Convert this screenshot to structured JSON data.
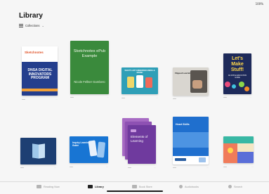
{
  "status": {
    "battery": "100%"
  },
  "header": {
    "title": "Library",
    "collections_label": "Collections"
  },
  "books": {
    "b1": {
      "brand": "Sketchnotes",
      "title": "DNSA DIGITAL INNOVATORS PROGRAM"
    },
    "b2": {
      "title": "Sketchnotes ePub Example",
      "author": "Nicole Fellner Gambero"
    },
    "b3": {
      "header": "WHAT'S ART EMBEDDED MEDIA & MORE!"
    },
    "b4": {
      "title": "Flipped Learning for Teaching"
    },
    "b5": {
      "title": "Let's Make Stuff!",
      "subtitle": "AN APPLE EDUCATION GUIDE"
    },
    "b7": {
      "title": "Inquiry Learning Guide"
    },
    "b8": {
      "title": "Elements of Learning"
    },
    "b9": {
      "title": "Heart Skills"
    }
  },
  "tabbar": {
    "reading_now": "Reading Now",
    "library": "Library",
    "book_store": "Book Store",
    "audiobooks": "Audiobooks",
    "search": "Search"
  },
  "colors": {
    "accent": "#222222",
    "inactive": "#9a9a9a"
  }
}
